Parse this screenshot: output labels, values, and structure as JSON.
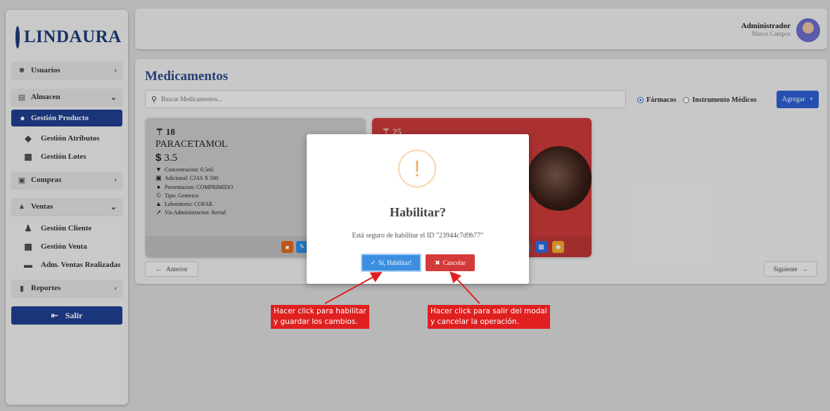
{
  "brand": {
    "name": "LINDAURA"
  },
  "header": {
    "user_name": "Administrador",
    "user_sub": "Marco Campos"
  },
  "sidebar": {
    "usuarios": "Usuarios",
    "almacen": "Almacen",
    "gestion_producto": "Gestión Producto",
    "gestion_atributos": "Gestión Atributos",
    "gestion_lotes": "Gestión Lotes",
    "compras": "Compras",
    "ventas": "Ventas",
    "gestion_cliente": "Gestión Cliente",
    "gestion_venta": "Gestión Venta",
    "adm_ventas": "Adm. Ventas Realizadas",
    "reportes": "Reportes",
    "salir": "Salir"
  },
  "main": {
    "title": "Medicamentos",
    "search_placeholder": "Buscar Medicamentos...",
    "radio_farmacos": "Fármacos",
    "radio_instrumentos": "Instrumento Médicos",
    "add_button": "Agregar",
    "prev": "Anterior",
    "next": "Siguiente"
  },
  "cards": [
    {
      "id": "18",
      "name": "PARACETAMOL",
      "price": "3.5",
      "concentracion": "Concentracion: 0.5ml",
      "adicional": "Adicional: CJAS X 500",
      "presentacion": "Presentacion: COMPRIMIDO",
      "tipo": "Tipo: Generico",
      "laboratorio": "Laboratorio: COFAR",
      "via": "Via Administracion: Rectal"
    },
    {
      "id": "25"
    }
  ],
  "modal": {
    "title": "Habilitar?",
    "text": "Está seguro de habilitar el ID \"23944c7d9b77\"",
    "confirm": "Sí, Habilitar!",
    "cancel": "Cancelar"
  },
  "annotations": {
    "confirm_note_1": "Hacer click para habilitar",
    "confirm_note_2": "y guardar los cambios.",
    "cancel_note_1": "Hacer click para salir del modal",
    "cancel_note_2": "y cancelar la operación."
  },
  "colors": {
    "brand": "#1c3d7a",
    "primary": "#2c5fd0",
    "danger": "#d43a3a",
    "warning": "#f0ad6b",
    "annotation": "#e02020"
  }
}
